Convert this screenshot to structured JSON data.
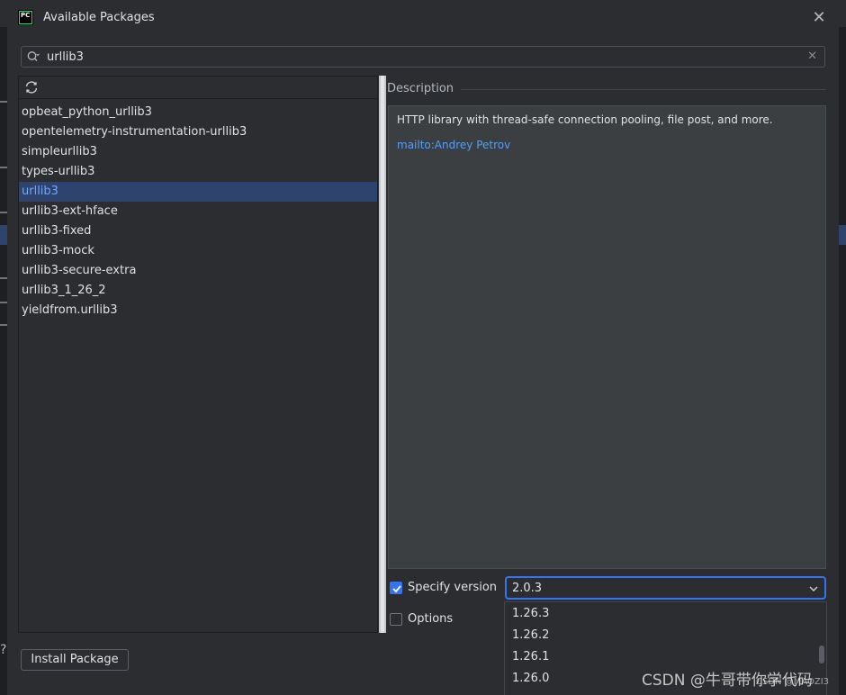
{
  "window": {
    "title": "Available Packages",
    "logo_text": "PC"
  },
  "search": {
    "value": "urllib3"
  },
  "packages": [
    "opbeat_python_urllib3",
    "opentelemetry-instrumentation-urllib3",
    "simpleurllib3",
    "types-urllib3",
    "urllib3",
    "urllib3-ext-hface",
    "urllib3-fixed",
    "urllib3-mock",
    "urllib3-secure-extra",
    "urllib3_1_26_2",
    "yieldfrom.urllib3"
  ],
  "selected_package": "urllib3",
  "description": {
    "label": "Description",
    "text": "HTTP library with thread-safe connection pooling, file post, and more.",
    "link": "mailto:Andrey Petrov"
  },
  "specify_version": {
    "label": "Specify version",
    "checked": true,
    "value": "2.0.3"
  },
  "options": {
    "label": "Options",
    "checked": false
  },
  "version_options": [
    "1.26.3",
    "1.26.2",
    "1.26.1",
    "1.26.0"
  ],
  "install_button": "Install Package",
  "watermark": "CSDN @牛哥带你学代码",
  "watermark_small": "CSDN @MAOZI3",
  "colors": {
    "accent": "#3574f0",
    "selection": "#2e436e",
    "link": "#589df6",
    "background": "#2b2d30"
  },
  "icons": {
    "logo": "pycharm-logo-icon",
    "close": "close-icon",
    "search": "search-icon",
    "clear": "clear-icon",
    "refresh": "refresh-icon",
    "chevron": "chevron-down-icon",
    "check": "check-icon"
  }
}
